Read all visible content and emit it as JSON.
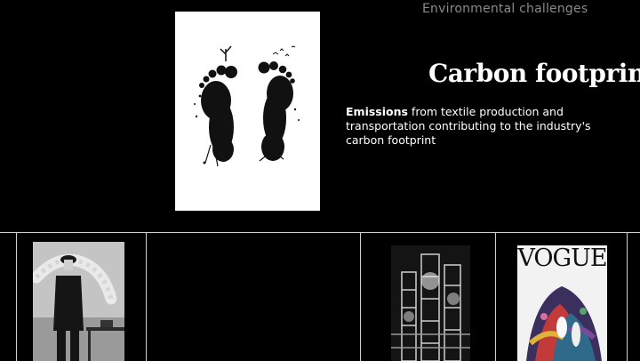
{
  "header": {
    "section_label": "Environmental challenges"
  },
  "slide": {
    "title": "Carbon footprint",
    "body_strong": "Emissions",
    "body_rest": " from textile production and transportation contributing to the industry's carbon footprint",
    "hero_image_icon": "footprints-with-trees-icon"
  },
  "thumbnails": [
    {
      "icon": "man-in-bowler-hat-photo"
    },
    {
      "icon": "industrial-plant-photo"
    },
    {
      "icon": "vogue-cover-photo",
      "masthead": "VOGUE"
    }
  ],
  "colors": {
    "background": "#000000",
    "label_gray": "#8a8a8a",
    "divider": "#cfcfcf",
    "text": "#ffffff"
  }
}
